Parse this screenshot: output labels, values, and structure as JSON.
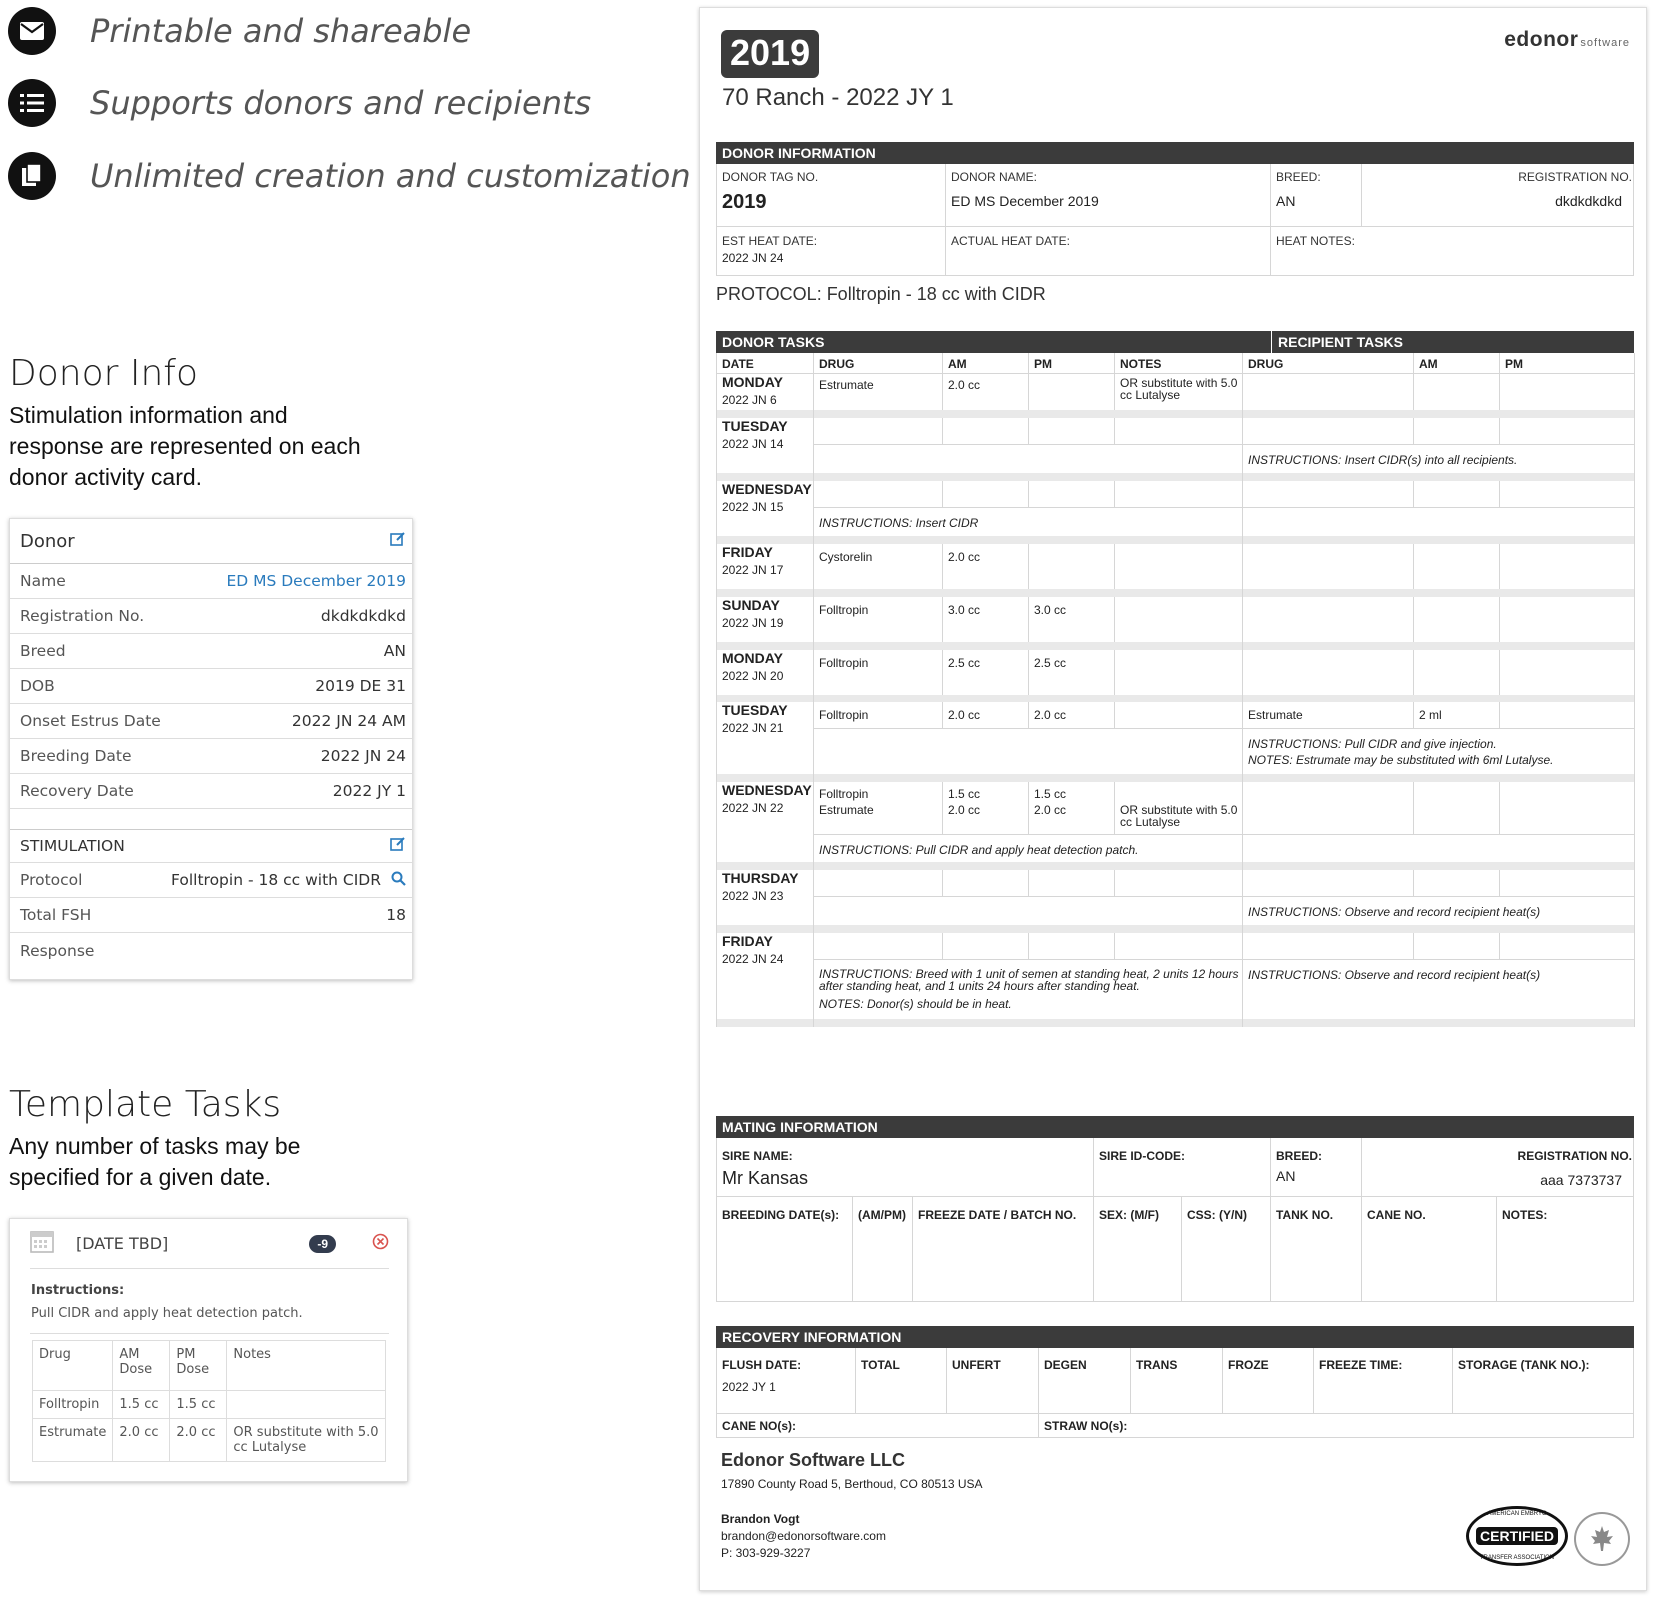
{
  "features": [
    {
      "icon": "envelope-icon",
      "text": "Printable and shareable"
    },
    {
      "icon": "list-icon",
      "text": "Supports donors and recipients"
    },
    {
      "icon": "copy-icon",
      "text": "Unlimited creation and customization"
    }
  ],
  "donor_info": {
    "title": "Donor Info",
    "desc": "Stimulation information and response are represented on each donor activity card.",
    "card": {
      "header": "Donor",
      "rows": [
        {
          "label": "Name",
          "value": "ED MS December 2019"
        },
        {
          "label": "Registration No.",
          "value": "dkdkdkdkd"
        },
        {
          "label": "Breed",
          "value": "AN"
        },
        {
          "label": "DOB",
          "value": "2019 DE 31"
        },
        {
          "label": "Onset Estrus Date",
          "value": "2022 JN 24 AM"
        },
        {
          "label": "Breeding Date",
          "value": "2022 JN 24"
        },
        {
          "label": "Recovery Date",
          "value": "2022 JY 1"
        }
      ],
      "stim_header": "STIMULATION",
      "stim_rows": [
        {
          "label": "Protocol",
          "value": "Folltropin - 18 cc with CIDR"
        },
        {
          "label": "Total FSH",
          "value": "18"
        },
        {
          "label": "Response",
          "value": ""
        }
      ]
    }
  },
  "template_tasks": {
    "title": "Template Tasks",
    "desc": "Any number of tasks may be specified for a given date.",
    "card": {
      "date": "[DATE TBD]",
      "badge": "-9",
      "instructions_label": "Instructions:",
      "instructions": "Pull CIDR and apply heat detection patch.",
      "headers": [
        "Drug",
        "AM Dose",
        "PM Dose",
        "Notes"
      ],
      "rows": [
        [
          "Folltropin",
          "1.5 cc",
          "1.5 cc",
          ""
        ],
        [
          "Estrumate",
          "2.0 cc",
          "2.0 cc",
          "OR substitute with 5.0 cc Lutalyse"
        ]
      ]
    }
  },
  "doc": {
    "tag": "2019",
    "brand": "edonor",
    "brand_sub": "software",
    "title": "70 Ranch - 2022 JY 1",
    "donor_bar": "DONOR INFORMATION",
    "donor_tag_label": "DONOR TAG NO.",
    "donor_tag": "2019",
    "donor_name_label": "DONOR NAME:",
    "donor_name": "ED MS December 2019",
    "breed_label": "BREED:",
    "breed": "AN",
    "reg_label": "REGISTRATION NO.",
    "reg": "dkdkdkdkd",
    "est_heat_label": "EST HEAT DATE:",
    "est_heat": "2022 JN 24",
    "actual_heat_label": "ACTUAL HEAT DATE:",
    "heat_notes_label": "HEAT NOTES:",
    "protocol": "PROTOCOL: Folltropin - 18 cc with CIDR",
    "donor_tasks_bar": "DONOR TASKS",
    "recipient_tasks_bar": "RECIPIENT TASKS",
    "task_cols": [
      "DATE",
      "DRUG",
      "AM",
      "PM",
      "NOTES",
      "DRUG",
      "AM",
      "PM"
    ],
    "days": [
      {
        "day": "MONDAY",
        "date": "2022 JN 6"
      },
      {
        "day": "TUESDAY",
        "date": "2022 JN 14"
      },
      {
        "day": "WEDNESDAY",
        "date": "2022 JN 15"
      },
      {
        "day": "FRIDAY",
        "date": "2022 JN 17"
      },
      {
        "day": "SUNDAY",
        "date": "2022 JN 19"
      },
      {
        "day": "MONDAY",
        "date": "2022 JN 20"
      },
      {
        "day": "TUESDAY",
        "date": "2022 JN 21"
      },
      {
        "day": "WEDNESDAY",
        "date": "2022 JN 22"
      },
      {
        "day": "THURSDAY",
        "date": "2022 JN 23"
      },
      {
        "day": "FRIDAY",
        "date": "2022 JN 24"
      }
    ],
    "cells": {
      "r0_drug": "Estrumate",
      "r0_am": "2.0 cc",
      "r0_notes": "OR substitute with 5.0 cc Lutalyse",
      "r1_instr": "INSTRUCTIONS: Insert CIDR(s) into all recipients.",
      "r2_instr": "INSTRUCTIONS: Insert CIDR",
      "r3_drug": "Cystorelin",
      "r3_am": "2.0 cc",
      "r4_drug": "Folltropin",
      "r4_am": "3.0 cc",
      "r4_pm": "3.0 cc",
      "r5_drug": "Folltropin",
      "r5_am": "2.5 cc",
      "r5_pm": "2.5 cc",
      "r6_drug": "Folltropin",
      "r6_am": "2.0 cc",
      "r6_pm": "2.0 cc",
      "r6_rdrug": "Estrumate",
      "r6_ram": "2 ml",
      "r6_rinstr": "INSTRUCTIONS: Pull CIDR and give injection.",
      "r6_rnotes": "NOTES: Estrumate may be substituted with 6ml Lutalyse.",
      "r7_drug1": "Folltropin",
      "r7_drug2": "Estrumate",
      "r7_am1": "1.5 cc",
      "r7_am2": "2.0 cc",
      "r7_pm1": "1.5 cc",
      "r7_pm2": "2.0 cc",
      "r7_notes": "OR substitute with 5.0 cc Lutalyse",
      "r7_instr": "INSTRUCTIONS: Pull CIDR and apply heat detection patch.",
      "r8_rinstr": "INSTRUCTIONS: Observe and record recipient heat(s)",
      "r9_instr": "INSTRUCTIONS: Breed with 1 unit of semen at standing heat, 2 units 12 hours after standing heat, and 1 units 24 hours after standing heat.",
      "r9_notes": "NOTES: Donor(s) should be in heat.",
      "r9_rinstr": "INSTRUCTIONS: Observe and record recipient heat(s)"
    },
    "mating_bar": "MATING INFORMATION",
    "sire_name_label": "SIRE NAME:",
    "sire_name": "Mr Kansas",
    "sire_id_label": "SIRE ID-CODE:",
    "mating_breed_label": "BREED:",
    "mating_breed": "AN",
    "mating_reg_label": "REGISTRATION NO.",
    "mating_reg": "aaa 7373737",
    "mating_cols": [
      "BREEDING DATE(s):",
      "(AM/PM)",
      "FREEZE DATE / BATCH NO.",
      "SEX: (M/F)",
      "CSS: (Y/N)",
      "TANK NO.",
      "CANE NO.",
      "NOTES:"
    ],
    "recovery_bar": "RECOVERY INFORMATION",
    "recovery_cols": [
      "FLUSH DATE:",
      "TOTAL",
      "UNFERT",
      "DEGEN",
      "TRANS",
      "FROZE",
      "FREEZE TIME:",
      "STORAGE (TANK NO.):"
    ],
    "flush_date": "2022 JY 1",
    "cane_label": "CANE NO(s):",
    "straw_label": "STRAW NO(s):",
    "company": "Edonor Software LLC",
    "address": "17890 County Road 5, Berthoud, CO 80513 USA",
    "contact_name": "Brandon Vogt",
    "contact_email": "brandon@edonorsoftware.com",
    "contact_phone": "P: 303-929-3227",
    "seal_text": "CERTIFIED",
    "seal_ring_top": "AMERICAN EMBRYO",
    "seal_ring_bottom": "TRANSFER ASSOCIATION"
  }
}
